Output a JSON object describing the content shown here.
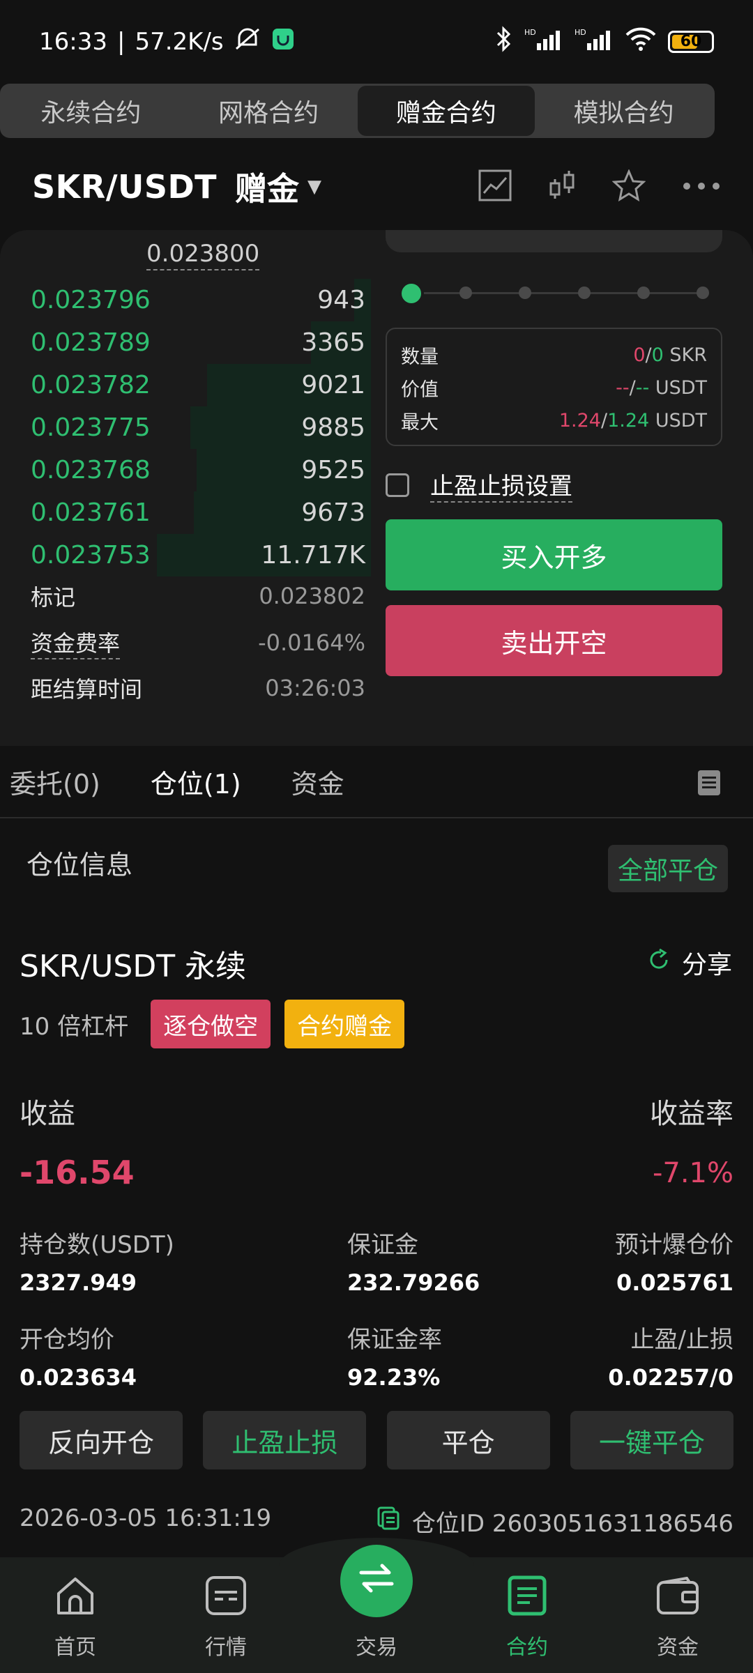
{
  "status_bar": {
    "time": "16:33",
    "sep": "|",
    "speed": "57.2K/s",
    "battery": "60"
  },
  "tabs": [
    "永续合约",
    "网格合约",
    "赠金合约",
    "模拟合约"
  ],
  "header": {
    "pair": "SKR/USDT",
    "bonus": "赠金"
  },
  "orderbook": {
    "top_price": "0.023800",
    "rows": [
      {
        "price": "0.023796",
        "qty": "943",
        "depth": 0.05
      },
      {
        "price": "0.023789",
        "qty": "3365",
        "depth": 0.18
      },
      {
        "price": "0.023782",
        "qty": "9021",
        "depth": 0.49
      },
      {
        "price": "0.023775",
        "qty": "9885",
        "depth": 0.54
      },
      {
        "price": "0.023768",
        "qty": "9525",
        "depth": 0.52
      },
      {
        "price": "0.023761",
        "qty": "9673",
        "depth": 0.53
      },
      {
        "price": "0.023753",
        "qty": "11.717K",
        "depth": 0.64
      }
    ]
  },
  "market_info": {
    "mark_label": "标记",
    "mark_value": "0.023802",
    "funding_label": "资金费率",
    "funding_value": "-0.0164%",
    "settle_label": "距结算时间",
    "settle_value": "03:26:03"
  },
  "order_form": {
    "qty_label": "数量",
    "qty_a": "0",
    "qty_sep": "/",
    "qty_b": "0",
    "qty_unit": "SKR",
    "value_label": "价值",
    "value_a": "--",
    "value_sep": "/",
    "value_b": "--",
    "value_unit": "USDT",
    "max_label": "最大",
    "max_a": "1.24",
    "max_sep": "/",
    "max_b": "1.24",
    "max_unit": "USDT",
    "tpsl_label": "止盈止损设置",
    "buy_label": "买入开多",
    "sell_label": "卖出开空"
  },
  "sub_tabs": [
    "委托(0)",
    "仓位(1)",
    "资金"
  ],
  "position": {
    "section_title": "仓位信息",
    "close_all": "全部平仓",
    "title": "SKR/USDT 永续",
    "share": "分享",
    "leverage": "10 倍杠杆",
    "tag_mode": "逐仓做空",
    "tag_bonus": "合约赠金",
    "pnl_label": "收益",
    "roe_label": "收益率",
    "pnl_value": "-16.54",
    "roe_value": "-7.1%",
    "size_label": "持仓数(USDT)",
    "size_value": "2327.949",
    "margin_label": "保证金",
    "margin_value": "232.79266",
    "liq_label": "预计爆仓价",
    "liq_value": "0.025761",
    "entry_label": "开仓均价",
    "entry_value": "0.023634",
    "margin_ratio_label": "保证金率",
    "margin_ratio_value": "92.23%",
    "tpsl_label": "止盈/止损",
    "tpsl_value": "0.02257/0",
    "actions": [
      "反向开仓",
      "止盈止损",
      "平仓",
      "一键平仓"
    ],
    "opened_at": "2026-03-05 16:31:19",
    "position_id": "仓位ID 2603051631186546"
  },
  "bottom_nav": [
    "首页",
    "行情",
    "交易",
    "合约",
    "资金"
  ],
  "colors": {
    "green": "#2fbf71",
    "red": "#e0476b",
    "yellow": "#f2b10f"
  }
}
